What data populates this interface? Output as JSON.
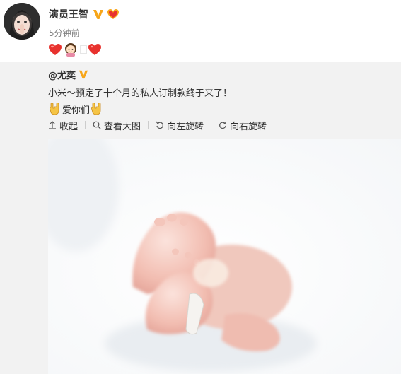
{
  "post": {
    "author_name": "演员王智",
    "time": "5分钟前",
    "verified_icon": "verified-v-icon",
    "level_icon": "fans-level-icon",
    "emojis": [
      "heart-icon",
      "girl-emoji-icon",
      "heart-icon"
    ]
  },
  "repost": {
    "mention": "@尤奕",
    "text": "小米～预定了十个月的私人订制款终于来了！",
    "love_text": "爱你们",
    "toolbar": {
      "collapse": "收起",
      "view_large": "查看大图",
      "rotate_left": "向左旋转",
      "rotate_right": "向右旋转"
    },
    "photo_subject": "baby-feet-photo"
  },
  "colors": {
    "accent_orange": "#f7a619",
    "repost_bg": "#f2f2f2",
    "heart_red": "#e8322e"
  }
}
